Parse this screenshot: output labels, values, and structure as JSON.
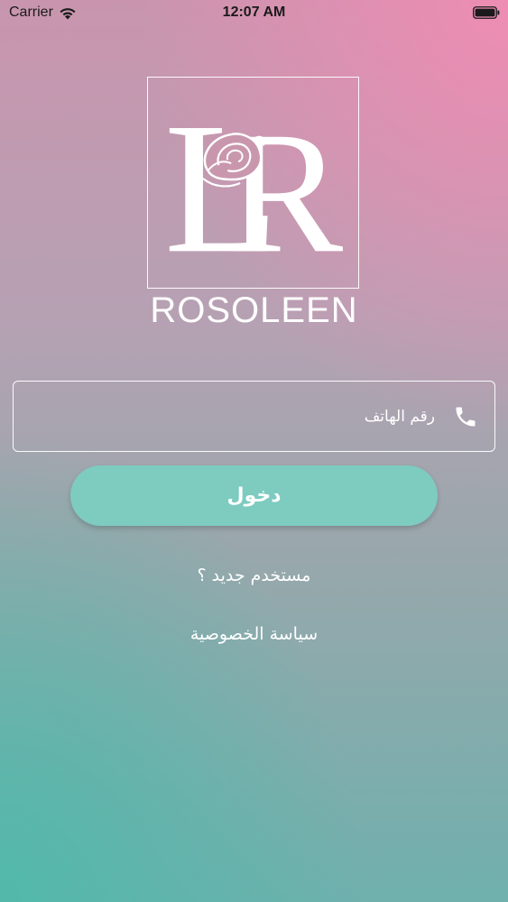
{
  "status_bar": {
    "carrier": "Carrier",
    "time": "12:07 AM"
  },
  "brand": {
    "name": "ROSOLEEN"
  },
  "phone_field": {
    "placeholder": "رقم الهاتف",
    "value": ""
  },
  "login_button": {
    "label": "دخول"
  },
  "links": {
    "new_user": "مستخدم جديد ؟",
    "privacy": "سياسة الخصوصية"
  },
  "colors": {
    "button": "#7ecbc0",
    "gradient_top_right": "#f08cb4",
    "gradient_bottom_left": "#50b9aa",
    "text": "#ffffff"
  },
  "icons": {
    "wifi": "wifi-icon",
    "battery": "battery-icon",
    "phone": "phone-icon",
    "logo": "rose-monogram-logo-icon"
  }
}
